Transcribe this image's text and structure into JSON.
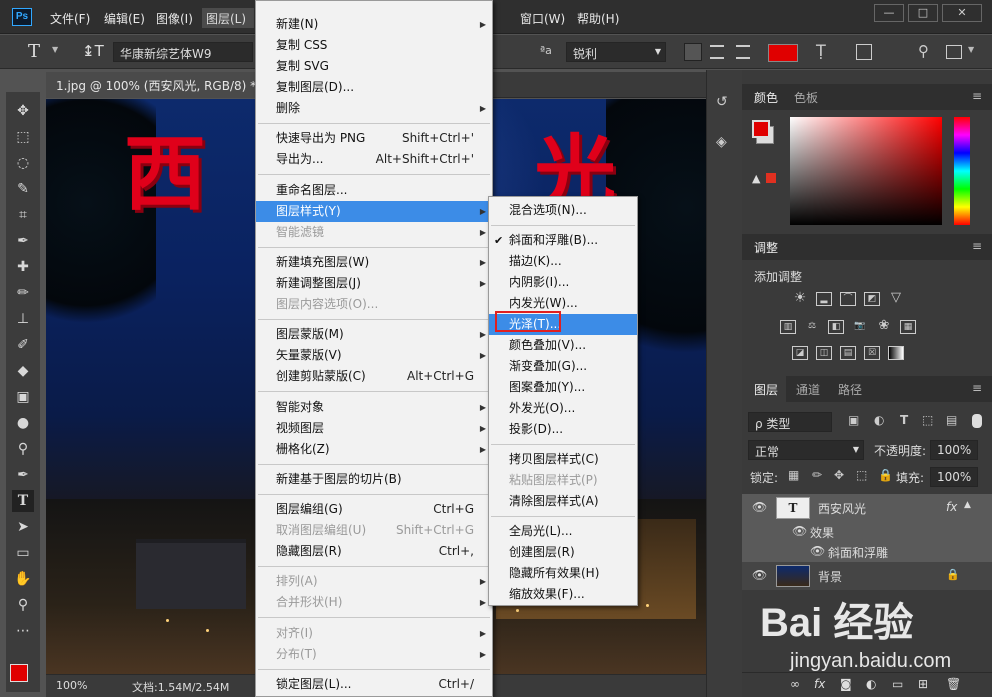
{
  "menubar": {
    "logo": "Ps",
    "items": [
      "文件(F)",
      "编辑(E)",
      "图像(I)",
      "图层(L)",
      "窗口(W)",
      "帮助(H)"
    ]
  },
  "window_controls": {
    "minimize": "—",
    "restore": "□",
    "close": "✕"
  },
  "options": {
    "tool_glyph": "T",
    "font_family": "华康新综艺体W9",
    "aa_label": "ªa",
    "aa_value": "锐利"
  },
  "document_tab": {
    "label": "1.jpg @ 100% (西安风光, RGB/8) *",
    "close": "×"
  },
  "canvas": {
    "title_text": "西安风光",
    "title_visible_left": "西",
    "title_visible_right": "光"
  },
  "status": {
    "zoom": "100%",
    "doc": "文档:1.54M/2.54M"
  },
  "color_panel": {
    "tabs": [
      "颜色",
      "色板"
    ],
    "fg_color": "#e00000",
    "bg_color": "#ffffff"
  },
  "adjust_panel": {
    "tab": "调整",
    "title": "添加调整"
  },
  "layers_panel": {
    "tabs": [
      "图层",
      "通道",
      "路径"
    ],
    "filter": "ρ 类型",
    "blend_mode": "正常",
    "opacity_label": "不透明度:",
    "opacity_value": "100%",
    "lock_label": "锁定:",
    "fill_label": "填充:",
    "fill_value": "100%",
    "layers": [
      {
        "name": "西安风光",
        "thumb": "T",
        "fx": "fx"
      },
      {
        "name": "效果"
      },
      {
        "name": "斜面和浮雕"
      },
      {
        "name": "背景"
      }
    ],
    "bottom_fx": "fx"
  },
  "layer_menu": {
    "items": [
      {
        "label": "新建(N)",
        "submenu": true
      },
      {
        "label": "复制 CSS"
      },
      {
        "label": "复制 SVG"
      },
      {
        "label": "复制图层(D)..."
      },
      {
        "label": "删除",
        "submenu": true
      },
      {
        "sep": true
      },
      {
        "label": "快速导出为 PNG",
        "shortcut": "Shift+Ctrl+'"
      },
      {
        "label": "导出为...",
        "shortcut": "Alt+Shift+Ctrl+'"
      },
      {
        "sep": true
      },
      {
        "label": "重命名图层..."
      },
      {
        "label": "图层样式(Y)",
        "submenu": true,
        "highlight": true
      },
      {
        "label": "智能滤镜",
        "submenu": true,
        "disabled": true
      },
      {
        "sep": true
      },
      {
        "label": "新建填充图层(W)",
        "submenu": true
      },
      {
        "label": "新建调整图层(J)",
        "submenu": true
      },
      {
        "label": "图层内容选项(O)...",
        "disabled": true
      },
      {
        "sep": true
      },
      {
        "label": "图层蒙版(M)",
        "submenu": true
      },
      {
        "label": "矢量蒙版(V)",
        "submenu": true
      },
      {
        "label": "创建剪贴蒙版(C)",
        "shortcut": "Alt+Ctrl+G"
      },
      {
        "sep": true
      },
      {
        "label": "智能对象",
        "submenu": true
      },
      {
        "label": "视频图层",
        "submenu": true
      },
      {
        "label": "栅格化(Z)",
        "submenu": true
      },
      {
        "sep": true
      },
      {
        "label": "新建基于图层的切片(B)"
      },
      {
        "sep": true
      },
      {
        "label": "图层编组(G)",
        "shortcut": "Ctrl+G"
      },
      {
        "label": "取消图层编组(U)",
        "shortcut": "Shift+Ctrl+G",
        "disabled": true
      },
      {
        "label": "隐藏图层(R)",
        "shortcut": "Ctrl+,"
      },
      {
        "sep": true
      },
      {
        "label": "排列(A)",
        "submenu": true,
        "disabled": true
      },
      {
        "label": "合并形状(H)",
        "submenu": true,
        "disabled": true
      },
      {
        "sep": true
      },
      {
        "label": "对齐(I)",
        "submenu": true,
        "disabled": true
      },
      {
        "label": "分布(T)",
        "submenu": true,
        "disabled": true
      },
      {
        "sep": true
      },
      {
        "label": "锁定图层(L)...",
        "shortcut": "Ctrl+/"
      }
    ]
  },
  "style_menu": {
    "items": [
      {
        "label": "混合选项(N)..."
      },
      {
        "sep": true
      },
      {
        "label": "斜面和浮雕(B)...",
        "checked": true
      },
      {
        "label": "描边(K)..."
      },
      {
        "label": "内阴影(I)..."
      },
      {
        "label": "内发光(W)..."
      },
      {
        "label": "光泽(T)...",
        "highlight": true
      },
      {
        "label": "颜色叠加(V)..."
      },
      {
        "label": "渐变叠加(G)..."
      },
      {
        "label": "图案叠加(Y)..."
      },
      {
        "label": "外发光(O)..."
      },
      {
        "label": "投影(D)..."
      },
      {
        "sep": true
      },
      {
        "label": "拷贝图层样式(C)"
      },
      {
        "label": "粘贴图层样式(P)",
        "disabled": true
      },
      {
        "label": "清除图层样式(A)"
      },
      {
        "sep": true
      },
      {
        "label": "全局光(L)..."
      },
      {
        "label": "创建图层(R)"
      },
      {
        "label": "隐藏所有效果(H)"
      },
      {
        "label": "缩放效果(F)..."
      }
    ]
  },
  "watermark": {
    "brand": "Bai  经验",
    "url": "jingyan.baidu.com"
  }
}
